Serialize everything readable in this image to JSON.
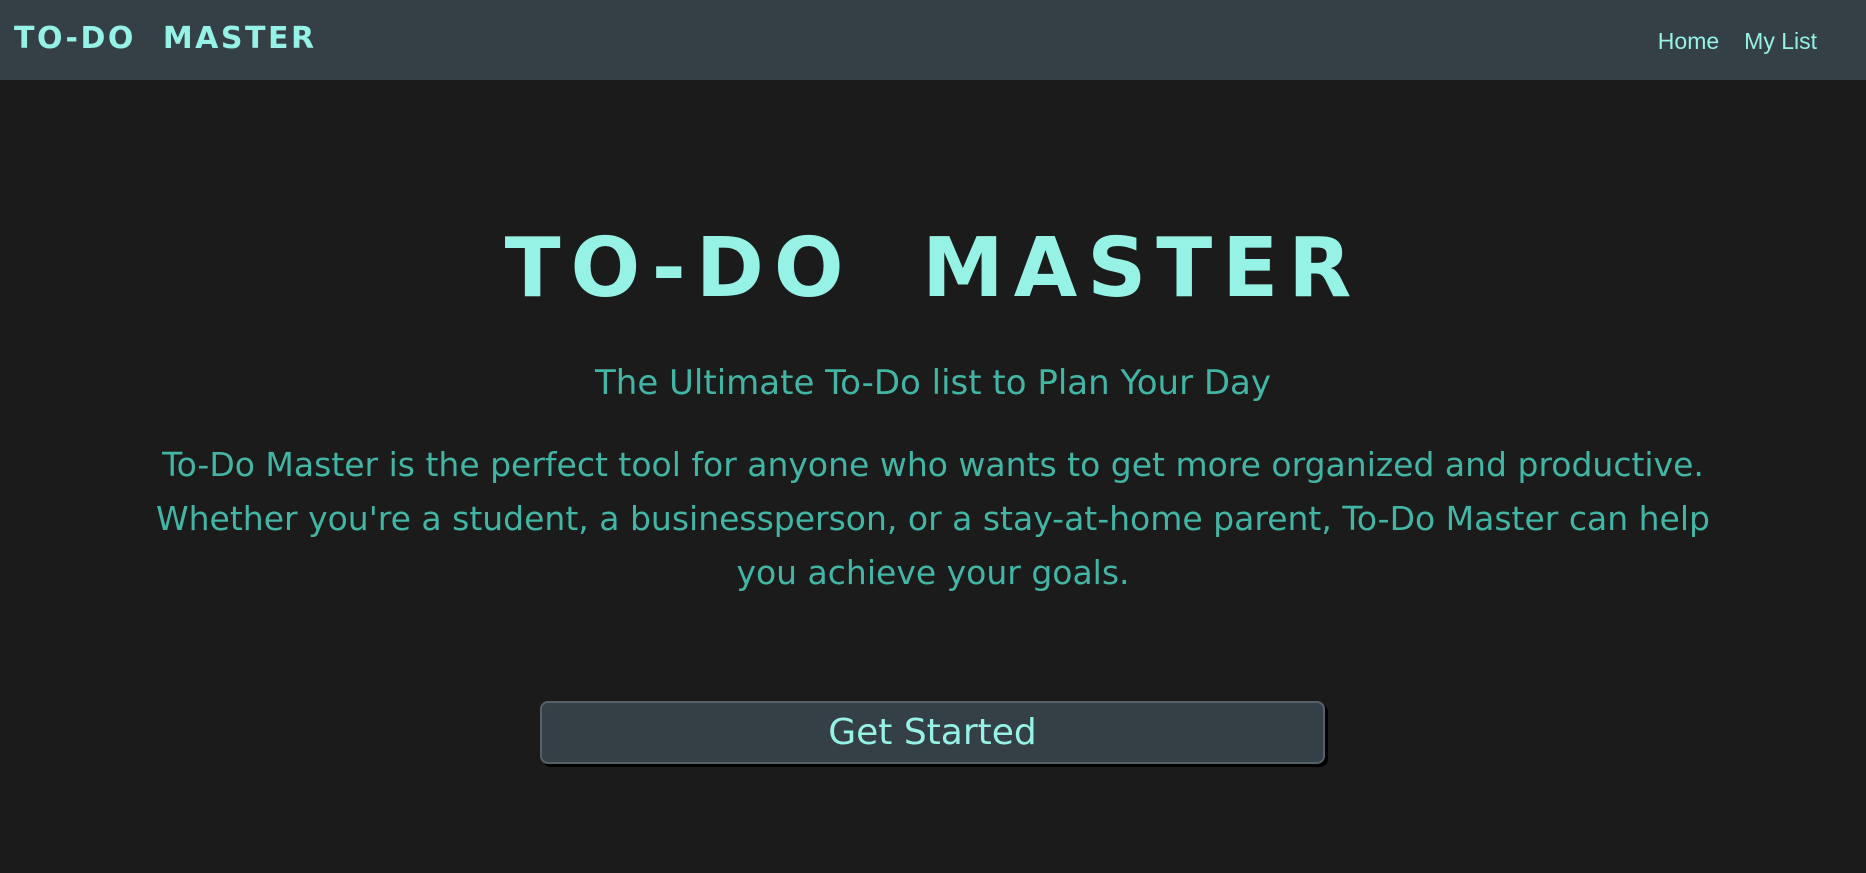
{
  "navbar": {
    "brand": "TO-DO MASTER",
    "links": [
      {
        "label": "Home"
      },
      {
        "label": "My List"
      }
    ]
  },
  "hero": {
    "title": "TO-DO MASTER",
    "subtitle": "The Ultimate To-Do list to Plan Your Day",
    "description": "To-Do Master is the perfect tool for anyone who wants to get more organized and productive. Whether you're a student, a businessperson, or a stay-at-home parent, To-Do Master can help you achieve your goals.",
    "cta_label": "Get Started"
  },
  "colors": {
    "background": "#1b1b1b",
    "navbar": "#353f46",
    "accent": "#96f2e4",
    "text_muted": "#43b5a5"
  }
}
